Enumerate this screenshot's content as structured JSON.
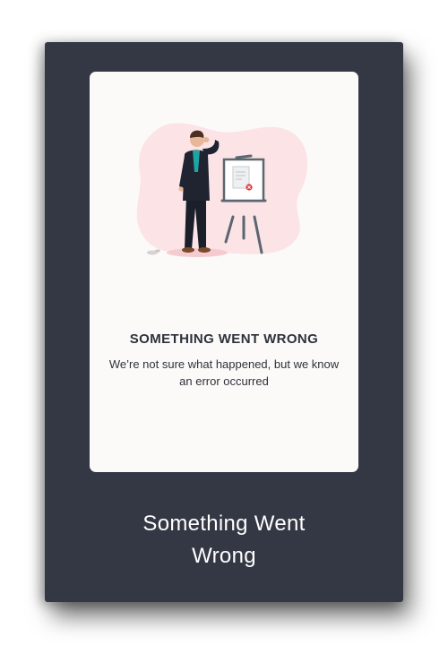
{
  "card": {
    "illustration_icon": "man-facepalm-at-error-easel-illustration",
    "title": "SOMETHING WENT WRONG",
    "message": "We’re not sure what happened, but we know an error occurred"
  },
  "caption": {
    "line1": "Something Went",
    "line2": "Wrong"
  },
  "colors": {
    "frame_background": "#333844",
    "card_background": "#fcfaf9",
    "blob_pink": "#fbe3e6",
    "error_red": "#e0353a",
    "suit": "#1f2430",
    "shirt": "#1fa3a3",
    "easel": "#5b6670"
  }
}
